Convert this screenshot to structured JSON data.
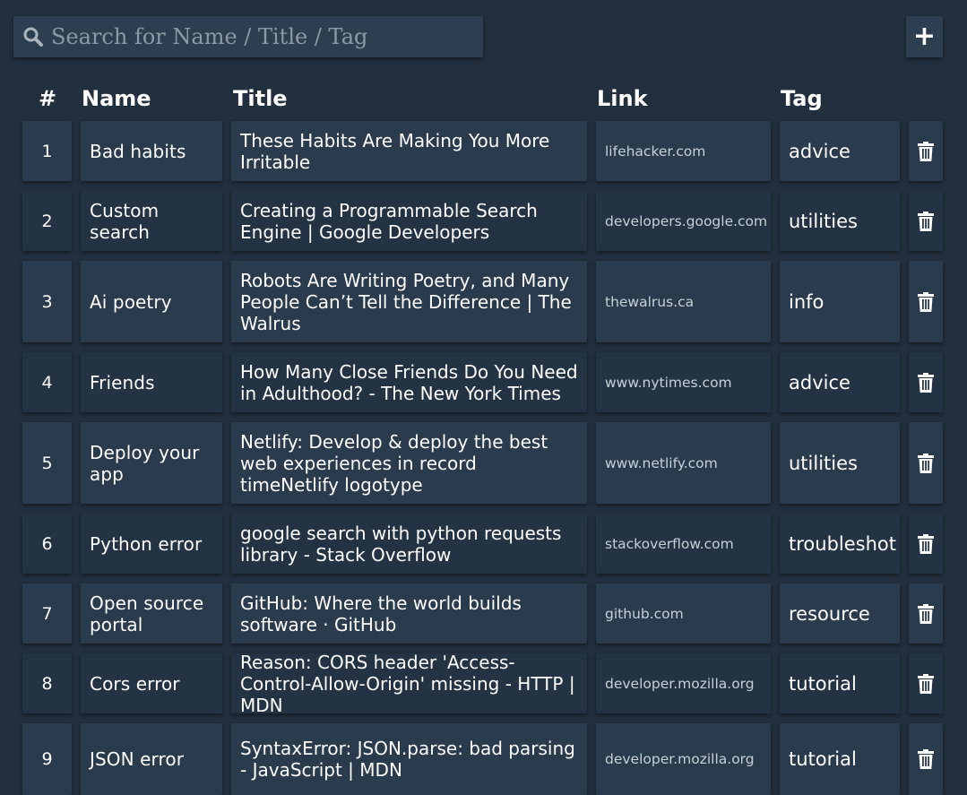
{
  "search": {
    "placeholder": "Search for Name / Title / Tag",
    "value": ""
  },
  "add_button": {
    "label": "+"
  },
  "columns": [
    "#",
    "Name",
    "Title",
    "Link",
    "Tag"
  ],
  "rows": [
    {
      "num": "1",
      "name": "Bad habits",
      "title": "These Habits Are Making You More Irritable",
      "link": "lifehacker.com",
      "tag": "advice"
    },
    {
      "num": "2",
      "name": "Custom search",
      "title": "Creating a Programmable Search Engine  |  Google Developers",
      "link": "developers.google.com",
      "tag": "utilities"
    },
    {
      "num": "3",
      "name": "Ai poetry",
      "title": "Robots Are Writing Poetry, and Many People Can’t Tell the Difference | The Walrus",
      "link": "thewalrus.ca",
      "tag": "info"
    },
    {
      "num": "4",
      "name": "Friends",
      "title": "How Many Close Friends Do You Need in Adulthood? - The New York Times",
      "link": "www.nytimes.com",
      "tag": "advice"
    },
    {
      "num": "5",
      "name": "Deploy your app",
      "title": "Netlify: Develop & deploy the best web experiences in record timeNetlify logotype",
      "link": "www.netlify.com",
      "tag": "utilities"
    },
    {
      "num": "6",
      "name": "Python error",
      "title": "google search with python requests library - Stack Overflow",
      "link": "stackoverflow.com",
      "tag": "troubleshot"
    },
    {
      "num": "7",
      "name": "Open source portal",
      "title": "GitHub: Where the world builds software · GitHub",
      "link": "github.com",
      "tag": "resource"
    },
    {
      "num": "8",
      "name": "Cors error",
      "title": "Reason: CORS header 'Access-Control-Allow-Origin' missing - HTTP | MDN",
      "link": "developer.mozilla.org",
      "tag": "tutorial"
    },
    {
      "num": "9",
      "name": "JSON error",
      "title": "SyntaxError: JSON.parse: bad parsing - JavaScript | MDN",
      "link": "developer.mozilla.org",
      "tag": "tutorial"
    }
  ],
  "icons": {
    "search": "search-icon",
    "delete": "trash-icon",
    "add": "plus-icon"
  },
  "colors": {
    "background": "#222f3e",
    "cell": "#2d3e50",
    "text": "#ffffff",
    "link": "#c7cfd7"
  }
}
